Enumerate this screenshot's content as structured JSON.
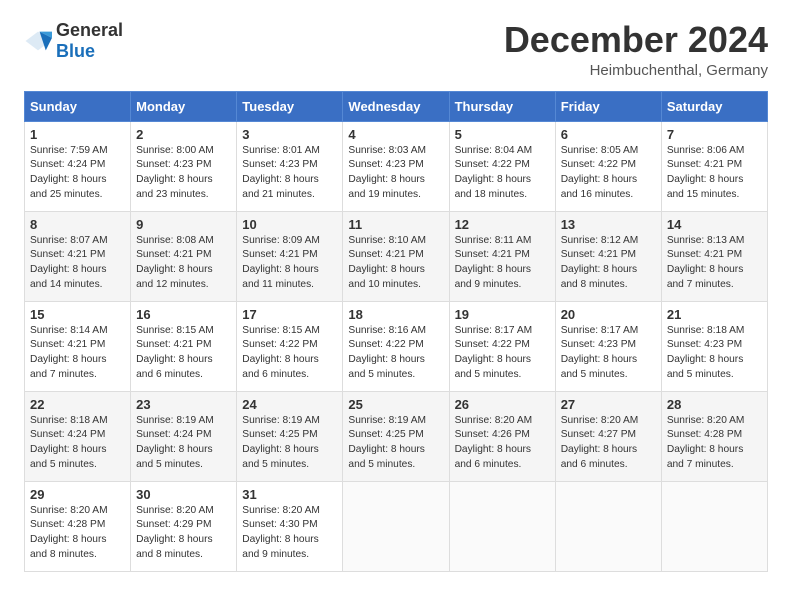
{
  "logo": {
    "general": "General",
    "blue": "Blue"
  },
  "title": "December 2024",
  "subtitle": "Heimbuchenthal, Germany",
  "days_of_week": [
    "Sunday",
    "Monday",
    "Tuesday",
    "Wednesday",
    "Thursday",
    "Friday",
    "Saturday"
  ],
  "weeks": [
    [
      {
        "day": "1",
        "sunrise": "Sunrise: 7:59 AM",
        "sunset": "Sunset: 4:24 PM",
        "daylight": "Daylight: 8 hours and 25 minutes."
      },
      {
        "day": "2",
        "sunrise": "Sunrise: 8:00 AM",
        "sunset": "Sunset: 4:23 PM",
        "daylight": "Daylight: 8 hours and 23 minutes."
      },
      {
        "day": "3",
        "sunrise": "Sunrise: 8:01 AM",
        "sunset": "Sunset: 4:23 PM",
        "daylight": "Daylight: 8 hours and 21 minutes."
      },
      {
        "day": "4",
        "sunrise": "Sunrise: 8:03 AM",
        "sunset": "Sunset: 4:23 PM",
        "daylight": "Daylight: 8 hours and 19 minutes."
      },
      {
        "day": "5",
        "sunrise": "Sunrise: 8:04 AM",
        "sunset": "Sunset: 4:22 PM",
        "daylight": "Daylight: 8 hours and 18 minutes."
      },
      {
        "day": "6",
        "sunrise": "Sunrise: 8:05 AM",
        "sunset": "Sunset: 4:22 PM",
        "daylight": "Daylight: 8 hours and 16 minutes."
      },
      {
        "day": "7",
        "sunrise": "Sunrise: 8:06 AM",
        "sunset": "Sunset: 4:21 PM",
        "daylight": "Daylight: 8 hours and 15 minutes."
      }
    ],
    [
      {
        "day": "8",
        "sunrise": "Sunrise: 8:07 AM",
        "sunset": "Sunset: 4:21 PM",
        "daylight": "Daylight: 8 hours and 14 minutes."
      },
      {
        "day": "9",
        "sunrise": "Sunrise: 8:08 AM",
        "sunset": "Sunset: 4:21 PM",
        "daylight": "Daylight: 8 hours and 12 minutes."
      },
      {
        "day": "10",
        "sunrise": "Sunrise: 8:09 AM",
        "sunset": "Sunset: 4:21 PM",
        "daylight": "Daylight: 8 hours and 11 minutes."
      },
      {
        "day": "11",
        "sunrise": "Sunrise: 8:10 AM",
        "sunset": "Sunset: 4:21 PM",
        "daylight": "Daylight: 8 hours and 10 minutes."
      },
      {
        "day": "12",
        "sunrise": "Sunrise: 8:11 AM",
        "sunset": "Sunset: 4:21 PM",
        "daylight": "Daylight: 8 hours and 9 minutes."
      },
      {
        "day": "13",
        "sunrise": "Sunrise: 8:12 AM",
        "sunset": "Sunset: 4:21 PM",
        "daylight": "Daylight: 8 hours and 8 minutes."
      },
      {
        "day": "14",
        "sunrise": "Sunrise: 8:13 AM",
        "sunset": "Sunset: 4:21 PM",
        "daylight": "Daylight: 8 hours and 7 minutes."
      }
    ],
    [
      {
        "day": "15",
        "sunrise": "Sunrise: 8:14 AM",
        "sunset": "Sunset: 4:21 PM",
        "daylight": "Daylight: 8 hours and 7 minutes."
      },
      {
        "day": "16",
        "sunrise": "Sunrise: 8:15 AM",
        "sunset": "Sunset: 4:21 PM",
        "daylight": "Daylight: 8 hours and 6 minutes."
      },
      {
        "day": "17",
        "sunrise": "Sunrise: 8:15 AM",
        "sunset": "Sunset: 4:22 PM",
        "daylight": "Daylight: 8 hours and 6 minutes."
      },
      {
        "day": "18",
        "sunrise": "Sunrise: 8:16 AM",
        "sunset": "Sunset: 4:22 PM",
        "daylight": "Daylight: 8 hours and 5 minutes."
      },
      {
        "day": "19",
        "sunrise": "Sunrise: 8:17 AM",
        "sunset": "Sunset: 4:22 PM",
        "daylight": "Daylight: 8 hours and 5 minutes."
      },
      {
        "day": "20",
        "sunrise": "Sunrise: 8:17 AM",
        "sunset": "Sunset: 4:23 PM",
        "daylight": "Daylight: 8 hours and 5 minutes."
      },
      {
        "day": "21",
        "sunrise": "Sunrise: 8:18 AM",
        "sunset": "Sunset: 4:23 PM",
        "daylight": "Daylight: 8 hours and 5 minutes."
      }
    ],
    [
      {
        "day": "22",
        "sunrise": "Sunrise: 8:18 AM",
        "sunset": "Sunset: 4:24 PM",
        "daylight": "Daylight: 8 hours and 5 minutes."
      },
      {
        "day": "23",
        "sunrise": "Sunrise: 8:19 AM",
        "sunset": "Sunset: 4:24 PM",
        "daylight": "Daylight: 8 hours and 5 minutes."
      },
      {
        "day": "24",
        "sunrise": "Sunrise: 8:19 AM",
        "sunset": "Sunset: 4:25 PM",
        "daylight": "Daylight: 8 hours and 5 minutes."
      },
      {
        "day": "25",
        "sunrise": "Sunrise: 8:19 AM",
        "sunset": "Sunset: 4:25 PM",
        "daylight": "Daylight: 8 hours and 5 minutes."
      },
      {
        "day": "26",
        "sunrise": "Sunrise: 8:20 AM",
        "sunset": "Sunset: 4:26 PM",
        "daylight": "Daylight: 8 hours and 6 minutes."
      },
      {
        "day": "27",
        "sunrise": "Sunrise: 8:20 AM",
        "sunset": "Sunset: 4:27 PM",
        "daylight": "Daylight: 8 hours and 6 minutes."
      },
      {
        "day": "28",
        "sunrise": "Sunrise: 8:20 AM",
        "sunset": "Sunset: 4:28 PM",
        "daylight": "Daylight: 8 hours and 7 minutes."
      }
    ],
    [
      {
        "day": "29",
        "sunrise": "Sunrise: 8:20 AM",
        "sunset": "Sunset: 4:28 PM",
        "daylight": "Daylight: 8 hours and 8 minutes."
      },
      {
        "day": "30",
        "sunrise": "Sunrise: 8:20 AM",
        "sunset": "Sunset: 4:29 PM",
        "daylight": "Daylight: 8 hours and 8 minutes."
      },
      {
        "day": "31",
        "sunrise": "Sunrise: 8:20 AM",
        "sunset": "Sunset: 4:30 PM",
        "daylight": "Daylight: 8 hours and 9 minutes."
      },
      null,
      null,
      null,
      null
    ]
  ]
}
